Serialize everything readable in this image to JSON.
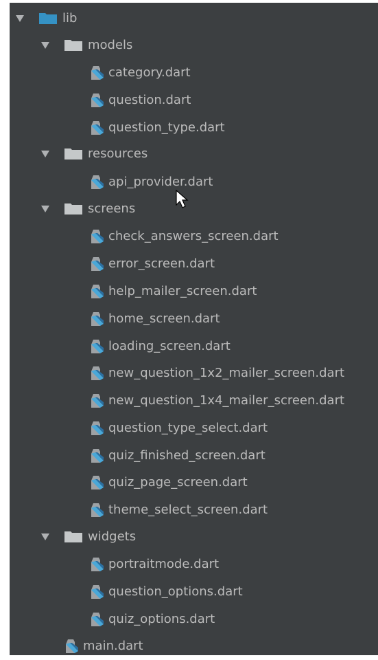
{
  "tree": {
    "root": {
      "label": "lib",
      "expanded": true,
      "icon": "folder-icon",
      "icon_color": "#3592c4"
    },
    "folder_color": "#c5c8c9",
    "dart_icon": "dart-file-icon",
    "folders": [
      {
        "label": "models",
        "expanded": true,
        "files": [
          "category.dart",
          "question.dart",
          "question_type.dart"
        ]
      },
      {
        "label": "resources",
        "expanded": true,
        "files": [
          "api_provider.dart"
        ]
      },
      {
        "label": "screens",
        "expanded": true,
        "files": [
          "check_answers_screen.dart",
          "error_screen.dart",
          "help_mailer_screen.dart",
          "home_screen.dart",
          "loading_screen.dart",
          "new_question_1x2_mailer_screen.dart",
          "new_question_1x4_mailer_screen.dart",
          "question_type_select.dart",
          "quiz_finished_screen.dart",
          "quiz_page_screen.dart",
          "theme_select_screen.dart"
        ]
      },
      {
        "label": "widgets",
        "expanded": true,
        "files": [
          "portraitmode.dart",
          "question_options.dart",
          "quiz_options.dart"
        ]
      }
    ],
    "root_files": [
      "main.dart"
    ]
  },
  "theme": {
    "background": "#3c3f41",
    "text": "#bbbbbb"
  }
}
